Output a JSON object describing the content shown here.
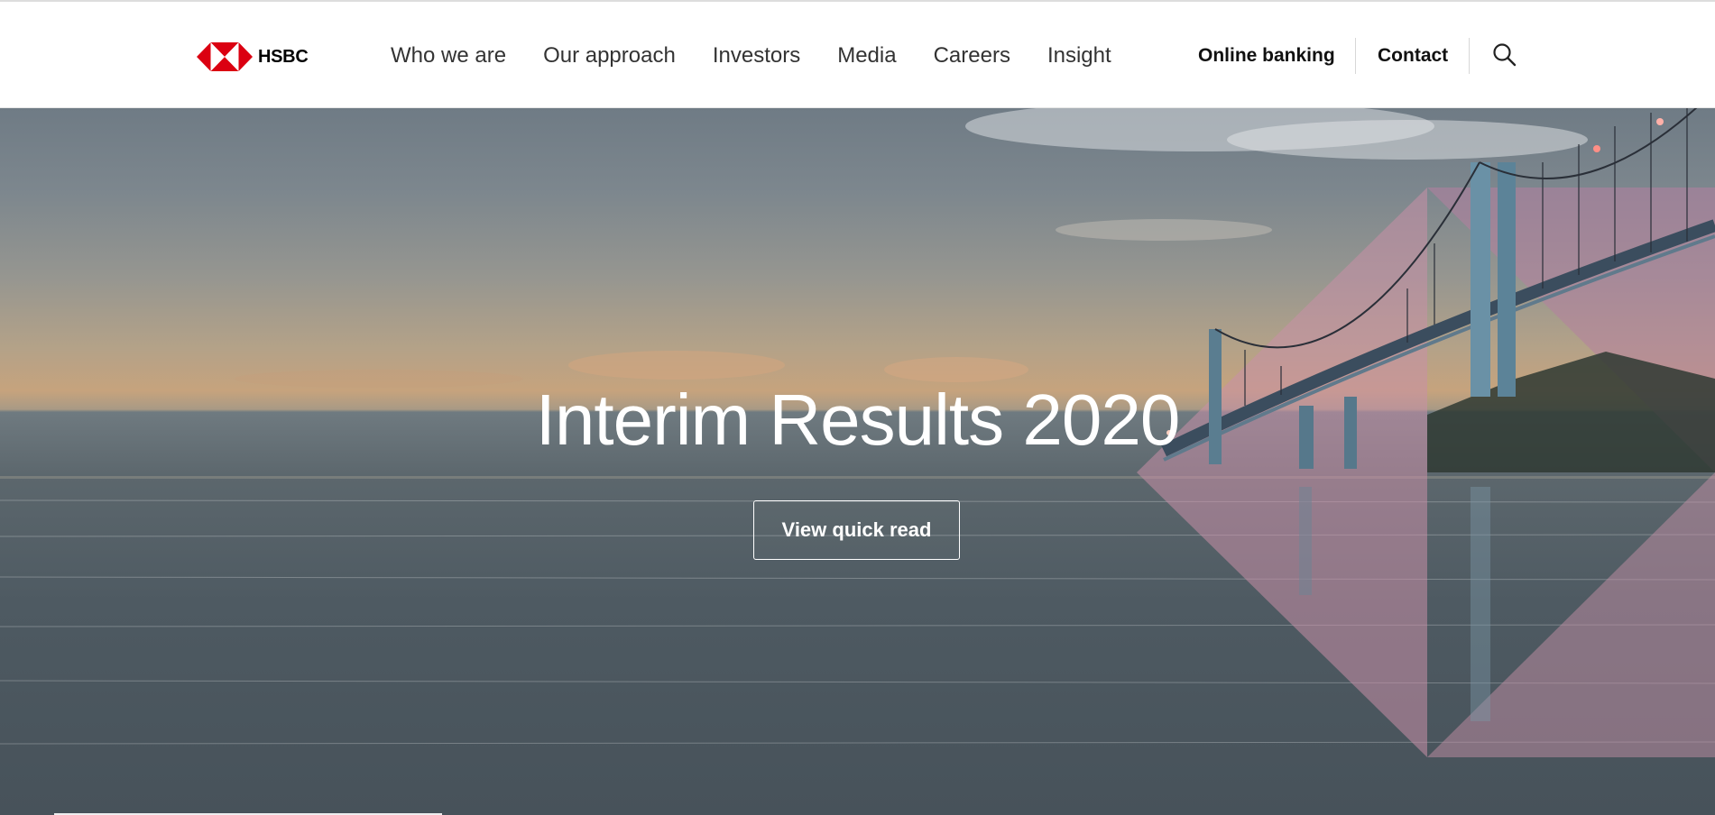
{
  "brand": {
    "name": "HSBC",
    "logo_color": "#db0011"
  },
  "nav": {
    "items": [
      {
        "label": "Who we are"
      },
      {
        "label": "Our approach"
      },
      {
        "label": "Investors"
      },
      {
        "label": "Media"
      },
      {
        "label": "Careers"
      },
      {
        "label": "Insight"
      }
    ]
  },
  "utility": {
    "online_banking": "Online banking",
    "contact": "Contact",
    "search_icon": "search-icon"
  },
  "hero": {
    "title": "Interim Results 2020",
    "cta_label": "View quick read",
    "accent_pink": "#c98fa8"
  }
}
